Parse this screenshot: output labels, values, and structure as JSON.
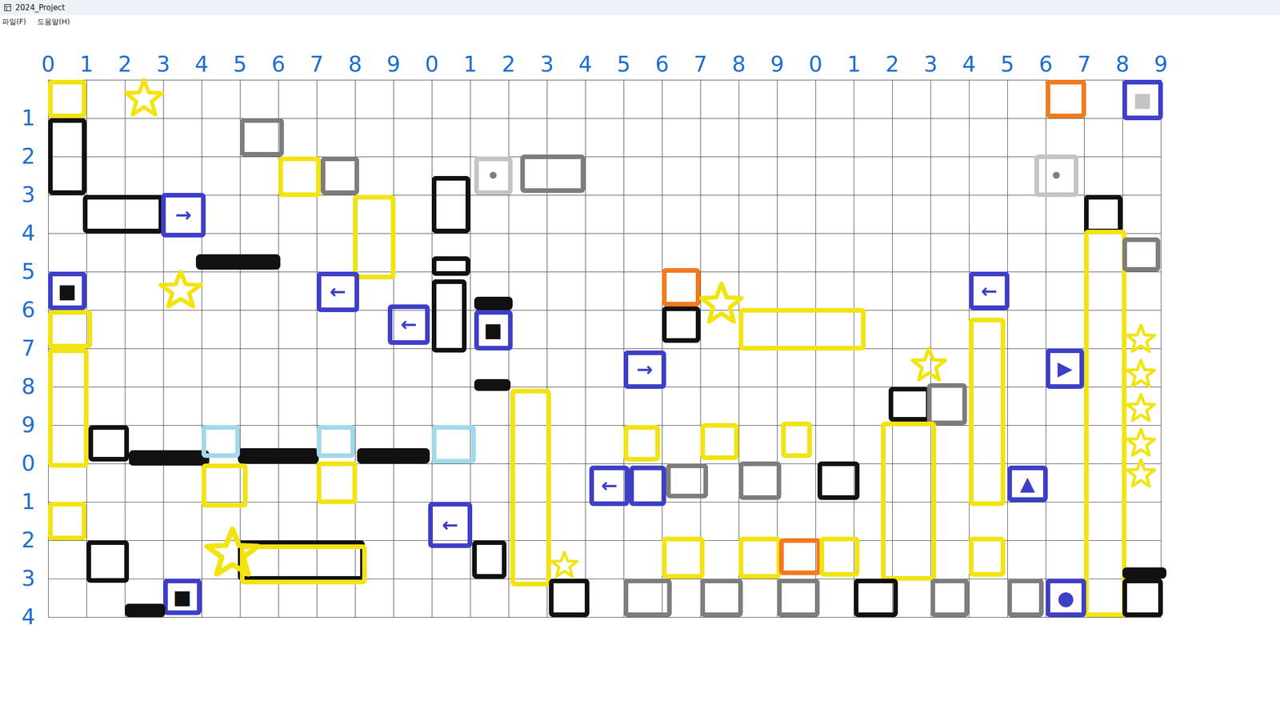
{
  "window": {
    "title": "2024_Project"
  },
  "menu": [
    {
      "label": "파일(F)"
    },
    {
      "label": "도움말(H)"
    }
  ],
  "grid": {
    "columns": 29,
    "rows": 14,
    "col_labels": [
      "0",
      "1",
      "2",
      "3",
      "4",
      "5",
      "6",
      "7",
      "8",
      "9",
      "0",
      "1",
      "2",
      "3",
      "4",
      "5",
      "6",
      "7",
      "8",
      "9",
      "0",
      "1",
      "2",
      "3",
      "4",
      "5",
      "6",
      "7",
      "8",
      "9"
    ],
    "row_labels": [
      "1",
      "2",
      "3",
      "4",
      "5",
      "6",
      "7",
      "8",
      "9",
      "0",
      "1",
      "2",
      "3",
      "4"
    ]
  },
  "tiles": [
    {
      "kind": "box",
      "color": "#f2e311",
      "col": 0,
      "row": 0,
      "w": 1,
      "h": 1
    },
    {
      "kind": "star",
      "color": "#f2e311",
      "col": 2,
      "row": 0,
      "w": 1,
      "h": 1
    },
    {
      "kind": "box",
      "color": "#f27a1e",
      "col": 26,
      "row": 0,
      "w": 1.05,
      "h": 1
    },
    {
      "kind": "box",
      "color": "#3d3fc8",
      "col": 28,
      "row": 0,
      "w": 1.05,
      "h": 1.05,
      "label": "■",
      "label_color": "#c4c4c4"
    },
    {
      "kind": "box",
      "color": "#111111",
      "col": 0,
      "row": 1,
      "w": 1,
      "h": 2
    },
    {
      "kind": "box",
      "color": "#111111",
      "col": 0.9,
      "row": 3,
      "w": 2.1,
      "h": 1
    },
    {
      "kind": "box",
      "color": "#3d3fc8",
      "col": 2.95,
      "row": 2.95,
      "w": 1.15,
      "h": 1.15,
      "label": "→",
      "label_color": "#3d3fc8"
    },
    {
      "kind": "box",
      "color": "#7d7d7d",
      "col": 5,
      "row": 1,
      "w": 1.15,
      "h": 1
    },
    {
      "kind": "box",
      "color": "#f2e311",
      "col": 6,
      "row": 2,
      "w": 1.1,
      "h": 1.05
    },
    {
      "kind": "box",
      "color": "#7d7d7d",
      "col": 7.1,
      "row": 2,
      "w": 1,
      "h": 1
    },
    {
      "kind": "box",
      "color": "#f2e311",
      "col": 7.95,
      "row": 3,
      "w": 1.1,
      "h": 2.2
    },
    {
      "kind": "bar",
      "color": "#111111",
      "col": 3.85,
      "row": 4.55,
      "w": 2.2,
      "h": 0.4
    },
    {
      "kind": "box",
      "color": "#3d3fc8",
      "col": 0,
      "row": 5,
      "w": 1,
      "h": 1,
      "label": "■",
      "label_color": "#111111"
    },
    {
      "kind": "star",
      "color": "#f2e311",
      "col": 2.9,
      "row": 5,
      "w": 1.1,
      "h": 1
    },
    {
      "kind": "box",
      "color": "#3d3fc8",
      "col": 7,
      "row": 5,
      "w": 1.1,
      "h": 1.05,
      "label": "←",
      "label_color": "#3d3fc8"
    },
    {
      "kind": "box",
      "color": "#3d3fc8",
      "col": 8.85,
      "row": 5.85,
      "w": 1.1,
      "h": 1.05,
      "label": "←",
      "label_color": "#3d3fc8"
    },
    {
      "kind": "box",
      "color": "#111111",
      "col": 10,
      "row": 2.5,
      "w": 1,
      "h": 1.5
    },
    {
      "kind": "box",
      "color": "#111111",
      "col": 10,
      "row": 4.6,
      "w": 1,
      "h": 0.5
    },
    {
      "kind": "box",
      "color": "#111111",
      "col": 10,
      "row": 5.2,
      "w": 0.9,
      "h": 1.9
    },
    {
      "kind": "box",
      "color": "#c4c4c4",
      "col": 11.1,
      "row": 2,
      "w": 1,
      "h": 1,
      "label": "•",
      "label_color": "#7d7d7d"
    },
    {
      "kind": "box",
      "color": "#7d7d7d",
      "col": 12.3,
      "row": 1.95,
      "w": 1.7,
      "h": 1
    },
    {
      "kind": "bar",
      "color": "#111111",
      "col": 11.1,
      "row": 5.65,
      "w": 1,
      "h": 0.35
    },
    {
      "kind": "box",
      "color": "#3d3fc8",
      "col": 11.1,
      "row": 6,
      "w": 1,
      "h": 1.05,
      "label": "■",
      "label_color": "#111111"
    },
    {
      "kind": "bar",
      "color": "#111111",
      "col": 11.1,
      "row": 7.8,
      "w": 0.95,
      "h": 0.3
    },
    {
      "kind": "box",
      "color": "#c4c4c4",
      "col": 25.7,
      "row": 1.95,
      "w": 1.15,
      "h": 1.1,
      "label": "•",
      "label_color": "#7d7d7d"
    },
    {
      "kind": "box",
      "color": "#111111",
      "col": 27,
      "row": 3,
      "w": 1,
      "h": 1
    },
    {
      "kind": "box",
      "color": "#f2e311",
      "col": 27,
      "row": 3.9,
      "w": 1.1,
      "h": 10.1
    },
    {
      "kind": "box",
      "color": "#7d7d7d",
      "col": 28,
      "row": 4.1,
      "w": 0.98,
      "h": 0.9
    },
    {
      "kind": "box",
      "color": "#f27a1e",
      "col": 16,
      "row": 4.9,
      "w": 1,
      "h": 1
    },
    {
      "kind": "box",
      "color": "#111111",
      "col": 16,
      "row": 5.9,
      "w": 1,
      "h": 0.95
    },
    {
      "kind": "star",
      "color": "#f2e311",
      "col": 17,
      "row": 5.3,
      "w": 1.1,
      "h": 1.1
    },
    {
      "kind": "box",
      "color": "#f2e311",
      "col": 18,
      "row": 5.95,
      "w": 3.3,
      "h": 1.1
    },
    {
      "kind": "box",
      "color": "#3d3fc8",
      "col": 15,
      "row": 7.05,
      "w": 1.1,
      "h": 1,
      "label": "→",
      "label_color": "#3d3fc8"
    },
    {
      "kind": "box",
      "color": "#3d3fc8",
      "col": 24,
      "row": 5,
      "w": 1.05,
      "h": 1,
      "label": "←",
      "label_color": "#3d3fc8"
    },
    {
      "kind": "box",
      "color": "#f2e311",
      "col": 24,
      "row": 6.2,
      "w": 0.95,
      "h": 4.9
    },
    {
      "kind": "star",
      "color": "#f2e311",
      "col": 22.5,
      "row": 7,
      "w": 0.9,
      "h": 0.9
    },
    {
      "kind": "box",
      "color": "#111111",
      "col": 21.9,
      "row": 8,
      "w": 1.1,
      "h": 0.9
    },
    {
      "kind": "box",
      "color": "#7d7d7d",
      "col": 22.9,
      "row": 7.9,
      "w": 1.05,
      "h": 1.1
    },
    {
      "kind": "box",
      "color": "#3d3fc8",
      "col": 26,
      "row": 7,
      "w": 1,
      "h": 1.05,
      "label": "▶",
      "label_color": "#3d3fc8"
    },
    {
      "kind": "star",
      "color": "#f2e311",
      "col": 28.1,
      "row": 6.4,
      "w": 0.75,
      "h": 0.75
    },
    {
      "kind": "star",
      "color": "#f2e311",
      "col": 28.1,
      "row": 7.3,
      "w": 0.75,
      "h": 0.75
    },
    {
      "kind": "star",
      "color": "#f2e311",
      "col": 28.1,
      "row": 8.2,
      "w": 0.75,
      "h": 0.75
    },
    {
      "kind": "star",
      "color": "#f2e311",
      "col": 28.1,
      "row": 9.1,
      "w": 0.75,
      "h": 0.75
    },
    {
      "kind": "star",
      "color": "#f2e311",
      "col": 28.1,
      "row": 9.9,
      "w": 0.75,
      "h": 0.75
    },
    {
      "kind": "box",
      "color": "#f2e311",
      "col": 0,
      "row": 6,
      "w": 1.15,
      "h": 1
    },
    {
      "kind": "box",
      "color": "#f2e311",
      "col": 0,
      "row": 7,
      "w": 1.05,
      "h": 3.1
    },
    {
      "kind": "box",
      "color": "#111111",
      "col": 1.05,
      "row": 9,
      "w": 1.05,
      "h": 0.95
    },
    {
      "kind": "bar",
      "color": "#111111",
      "col": 2.1,
      "row": 9.65,
      "w": 2.1,
      "h": 0.4
    },
    {
      "kind": "bar",
      "color": "#111111",
      "col": 4.95,
      "row": 9.6,
      "w": 2.1,
      "h": 0.4
    },
    {
      "kind": "bar",
      "color": "#111111",
      "col": 8.05,
      "row": 9.6,
      "w": 1.9,
      "h": 0.4
    },
    {
      "kind": "box",
      "color": "#a2d9ea",
      "col": 4,
      "row": 9,
      "w": 1,
      "h": 0.85
    },
    {
      "kind": "box",
      "color": "#a2d9ea",
      "col": 7,
      "row": 9,
      "w": 1,
      "h": 0.85
    },
    {
      "kind": "box",
      "color": "#a2d9ea",
      "col": 10,
      "row": 9,
      "w": 1.15,
      "h": 1
    },
    {
      "kind": "box",
      "color": "#f2e311",
      "col": 4,
      "row": 10,
      "w": 1.2,
      "h": 1.15
    },
    {
      "kind": "box",
      "color": "#f2e311",
      "col": 7,
      "row": 9.95,
      "w": 1.05,
      "h": 1.1
    },
    {
      "kind": "box",
      "color": "#f2e311",
      "col": 0,
      "row": 11,
      "w": 1,
      "h": 1
    },
    {
      "kind": "box",
      "color": "#3d3fc8",
      "col": 9.9,
      "row": 11,
      "w": 1.15,
      "h": 1.2,
      "label": "←",
      "label_color": "#3d3fc8"
    },
    {
      "kind": "box",
      "color": "#f2e311",
      "col": 12.05,
      "row": 8.05,
      "w": 1.05,
      "h": 5.15
    },
    {
      "kind": "box",
      "color": "#111111",
      "col": 1,
      "row": 12,
      "w": 1.1,
      "h": 1.1
    },
    {
      "kind": "box",
      "color": "#111111",
      "col": 4.95,
      "row": 12,
      "w": 3.3,
      "h": 1.05
    },
    {
      "kind": "box",
      "color": "#f2e311",
      "col": 5,
      "row": 12.1,
      "w": 3.3,
      "h": 1.05
    },
    {
      "kind": "star",
      "color": "#f2e311",
      "col": 4.1,
      "row": 11.7,
      "w": 1.4,
      "h": 1.3
    },
    {
      "kind": "box",
      "color": "#3d3fc8",
      "col": 3,
      "row": 13,
      "w": 1,
      "h": 0.95,
      "label": "■",
      "label_color": "#111111"
    },
    {
      "kind": "bar",
      "color": "#111111",
      "col": 2,
      "row": 13.65,
      "w": 1.05,
      "h": 0.35
    },
    {
      "kind": "box",
      "color": "#111111",
      "col": 11.05,
      "row": 12,
      "w": 0.9,
      "h": 1
    },
    {
      "kind": "star",
      "color": "#f2e311",
      "col": 13.1,
      "row": 12.3,
      "w": 0.7,
      "h": 0.7
    },
    {
      "kind": "box",
      "color": "#111111",
      "col": 13.05,
      "row": 13,
      "w": 1.05,
      "h": 1
    },
    {
      "kind": "box",
      "color": "#3d3fc8",
      "col": 14.1,
      "row": 10.05,
      "w": 1.05,
      "h": 1.05,
      "label": "←",
      "label_color": "#3d3fc8"
    },
    {
      "kind": "box",
      "color": "#3d3fc8",
      "col": 15.15,
      "row": 10.05,
      "w": 0.95,
      "h": 1.05,
      "label": "●",
      "label_color": "#ffffff"
    },
    {
      "kind": "box",
      "color": "#f2e311",
      "col": 15,
      "row": 9,
      "w": 0.95,
      "h": 0.95
    },
    {
      "kind": "box",
      "color": "#7d7d7d",
      "col": 16.1,
      "row": 10,
      "w": 1.1,
      "h": 0.9
    },
    {
      "kind": "box",
      "color": "#f2e311",
      "col": 17,
      "row": 8.95,
      "w": 1,
      "h": 0.95
    },
    {
      "kind": "box",
      "color": "#7d7d7d",
      "col": 18,
      "row": 9.95,
      "w": 1.1,
      "h": 1
    },
    {
      "kind": "box",
      "color": "#f2e311",
      "col": 19.1,
      "row": 8.9,
      "w": 0.8,
      "h": 0.95
    },
    {
      "kind": "box",
      "color": "#111111",
      "col": 20.05,
      "row": 9.95,
      "w": 1.1,
      "h": 1
    },
    {
      "kind": "box",
      "color": "#f2e311",
      "col": 21.7,
      "row": 8.9,
      "w": 1.45,
      "h": 4.15
    },
    {
      "kind": "box",
      "color": "#3d3fc8",
      "col": 25,
      "row": 10.05,
      "w": 1.05,
      "h": 0.95,
      "label": "▲",
      "label_color": "#3d3fc8"
    },
    {
      "kind": "box",
      "color": "#f2e311",
      "col": 16,
      "row": 11.9,
      "w": 1.1,
      "h": 1.1
    },
    {
      "kind": "box",
      "color": "#f2e311",
      "col": 18,
      "row": 11.9,
      "w": 1.1,
      "h": 1.1
    },
    {
      "kind": "box",
      "color": "#f27a1e",
      "col": 19.05,
      "row": 11.95,
      "w": 1.1,
      "h": 0.95
    },
    {
      "kind": "box",
      "color": "#f2e311",
      "col": 20.1,
      "row": 11.9,
      "w": 1.05,
      "h": 1.05
    },
    {
      "kind": "box",
      "color": "#f2e311",
      "col": 24,
      "row": 11.9,
      "w": 0.95,
      "h": 1.05
    },
    {
      "kind": "box",
      "color": "#7d7d7d",
      "col": 15,
      "row": 13,
      "w": 1.25,
      "h": 1
    },
    {
      "kind": "box",
      "color": "#7d7d7d",
      "col": 17,
      "row": 13,
      "w": 1.1,
      "h": 1
    },
    {
      "kind": "box",
      "color": "#7d7d7d",
      "col": 19,
      "row": 13,
      "w": 1.1,
      "h": 1
    },
    {
      "kind": "box",
      "color": "#111111",
      "col": 21,
      "row": 13,
      "w": 1.15,
      "h": 1
    },
    {
      "kind": "box",
      "color": "#7d7d7d",
      "col": 23,
      "row": 13,
      "w": 1,
      "h": 1
    },
    {
      "kind": "box",
      "color": "#7d7d7d",
      "col": 25,
      "row": 13,
      "w": 0.95,
      "h": 1
    },
    {
      "kind": "box",
      "color": "#3d3fc8",
      "col": 26,
      "row": 13,
      "w": 1.05,
      "h": 1,
      "label": "●",
      "label_color": "#3d3fc8"
    },
    {
      "kind": "bar",
      "color": "#111111",
      "col": 28,
      "row": 12.7,
      "w": 1.15,
      "h": 0.3
    },
    {
      "kind": "box",
      "color": "#111111",
      "col": 28,
      "row": 13,
      "w": 1.05,
      "h": 1
    }
  ]
}
